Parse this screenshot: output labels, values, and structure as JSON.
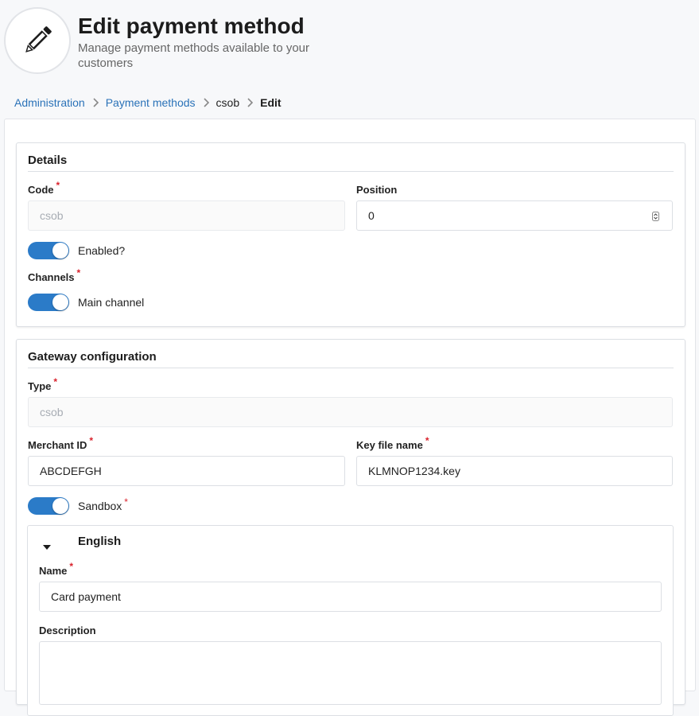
{
  "header": {
    "title": "Edit payment method",
    "subtitle": "Manage payment methods available to your customers",
    "icon": "pencil-icon"
  },
  "breadcrumb": {
    "items": [
      "Administration",
      "Payment methods",
      "csob"
    ],
    "current": "Edit"
  },
  "details": {
    "title": "Details",
    "code_label": "Code",
    "code_value": "csob",
    "position_label": "Position",
    "position_value": "0",
    "enabled_label": "Enabled?",
    "enabled": true,
    "channels_label": "Channels",
    "main_channel_label": "Main channel",
    "main_channel_enabled": true
  },
  "gateway": {
    "title": "Gateway configuration",
    "type_label": "Type",
    "type_value": "csob",
    "merchant_label": "Merchant ID",
    "merchant_value": "ABCDEFGH",
    "keyfile_label": "Key file name",
    "keyfile_value": "KLMNOP1234.key",
    "sandbox_label": "Sandbox",
    "sandbox_enabled": true
  },
  "translation": {
    "language": "English",
    "name_label": "Name",
    "name_value": "Card payment",
    "description_label": "Description",
    "description_value": ""
  },
  "colors": {
    "accent": "#2b7bc8",
    "link": "#2a72b8",
    "required": "#d9232d"
  }
}
